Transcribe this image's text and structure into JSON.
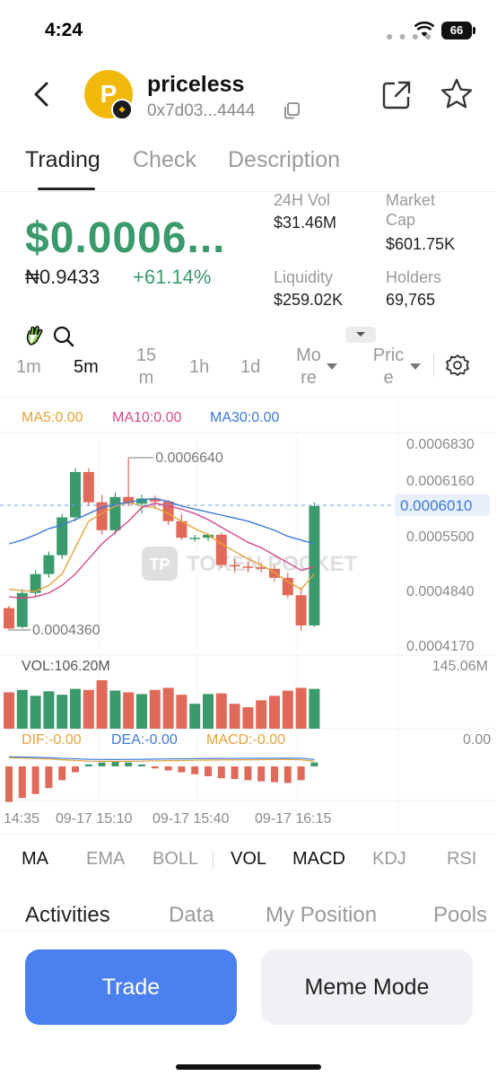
{
  "status_bar": {
    "time": "4:24",
    "battery": "66"
  },
  "header": {
    "token_name": "priceless",
    "token_address": "0x7d03...4444",
    "logo_letter": "P"
  },
  "tabs": [
    {
      "label": "Trading",
      "active": true
    },
    {
      "label": "Check",
      "active": false
    },
    {
      "label": "Description",
      "active": false
    }
  ],
  "price": {
    "usd": "$0.0006...",
    "ngn": "₦0.9433",
    "change": "+61.14%",
    "up_color": "#3b9a6b",
    "down_color": "#e06a5a"
  },
  "stats": {
    "vol_label": "24H Vol",
    "vol_value": "$31.46M",
    "mcap_label": "Market Cap",
    "mcap_value": "$601.75K",
    "liq_label": "Liquidity",
    "liq_value": "$259.02K",
    "holders_label": "Holders",
    "holders_value": "69,765"
  },
  "timeframes": {
    "items": [
      "1m",
      "5m",
      "15 m",
      "1h",
      "1d"
    ],
    "active": "5m",
    "more_label": "Mo re",
    "price_label": "Pric e"
  },
  "chart_data": {
    "type": "candlestick",
    "ma_labels": {
      "ma5": "MA5:0.00",
      "ma10": "MA10:0.00",
      "ma30": "MA30:0.00",
      "ma5_color": "#e6a23c",
      "ma10_color": "#d6488e",
      "ma30_color": "#3c7ad6"
    },
    "y_ticks": [
      "0.0006830",
      "0.0006160",
      "0.0005500",
      "0.0004840",
      "0.0004170"
    ],
    "ylim": [
      0.000417,
      0.000683
    ],
    "current_price": "0.0006010",
    "current_value": 0.000601,
    "high_marker": "0.0006640",
    "high_value": 0.000664,
    "low_marker": "0.0004360",
    "low_value": 0.000436,
    "candles": [
      {
        "o": 0.000465,
        "h": 0.000468,
        "l": 0.000436,
        "c": 0.000438
      },
      {
        "o": 0.00044,
        "h": 0.00049,
        "l": 0.000438,
        "c": 0.000485
      },
      {
        "o": 0.000485,
        "h": 0.000515,
        "l": 0.00048,
        "c": 0.00051
      },
      {
        "o": 0.00051,
        "h": 0.00054,
        "l": 0.000505,
        "c": 0.000535
      },
      {
        "o": 0.000535,
        "h": 0.00059,
        "l": 0.00053,
        "c": 0.000585
      },
      {
        "o": 0.000585,
        "h": 0.00065,
        "l": 0.00058,
        "c": 0.000645
      },
      {
        "o": 0.000645,
        "h": 0.00065,
        "l": 0.0006,
        "c": 0.000605
      },
      {
        "o": 0.000605,
        "h": 0.000615,
        "l": 0.000562,
        "c": 0.000568
      },
      {
        "o": 0.000568,
        "h": 0.000618,
        "l": 0.000562,
        "c": 0.000612
      },
      {
        "o": 0.000612,
        "h": 0.000664,
        "l": 0.0006,
        "c": 0.000603
      },
      {
        "o": 0.000603,
        "h": 0.000615,
        "l": 0.00059,
        "c": 0.00061
      },
      {
        "o": 0.00061,
        "h": 0.000614,
        "l": 0.000596,
        "c": 0.000606
      },
      {
        "o": 0.000606,
        "h": 0.000608,
        "l": 0.000575,
        "c": 0.00058
      },
      {
        "o": 0.00058,
        "h": 0.00059,
        "l": 0.000555,
        "c": 0.000558
      },
      {
        "o": 0.000558,
        "h": 0.000562,
        "l": 0.000553,
        "c": 0.000558
      },
      {
        "o": 0.000558,
        "h": 0.000564,
        "l": 0.000554,
        "c": 0.000562
      },
      {
        "o": 0.000562,
        "h": 0.000565,
        "l": 0.000518,
        "c": 0.000522
      },
      {
        "o": 0.000522,
        "h": 0.00053,
        "l": 0.000512,
        "c": 0.00052
      },
      {
        "o": 0.00052,
        "h": 0.000526,
        "l": 0.000512,
        "c": 0.000519
      },
      {
        "o": 0.000519,
        "h": 0.000525,
        "l": 0.000512,
        "c": 0.000517
      },
      {
        "o": 0.000517,
        "h": 0.000522,
        "l": 0.0005,
        "c": 0.000505
      },
      {
        "o": 0.000505,
        "h": 0.000512,
        "l": 0.000478,
        "c": 0.000482
      },
      {
        "o": 0.000482,
        "h": 0.000492,
        "l": 0.000435,
        "c": 0.000442
      },
      {
        "o": 0.000442,
        "h": 0.000605,
        "l": 0.00044,
        "c": 0.0006
      }
    ],
    "ma5": [
      0.00049,
      0.000488,
      0.000487,
      0.000495,
      0.00051,
      0.000545,
      0.00058,
      0.00059,
      0.0006,
      0.000605,
      0.0006,
      0.000598,
      0.00059,
      0.00058,
      0.00057,
      0.000562,
      0.00055,
      0.00054,
      0.00053,
      0.000522,
      0.000512,
      0.0005,
      0.00049,
      0.00051
    ],
    "ma10": [
      0.00048,
      0.000478,
      0.00048,
      0.000485,
      0.000495,
      0.00051,
      0.00053,
      0.00055,
      0.000565,
      0.00058,
      0.000598,
      0.000604,
      0.0006,
      0.000596,
      0.00059,
      0.000582,
      0.000572,
      0.000562,
      0.000552,
      0.000545,
      0.000535,
      0.000525,
      0.000515,
      0.00052
    ],
    "ma30": [
      0.00055,
      0.000555,
      0.000562,
      0.00057,
      0.000575,
      0.000582,
      0.00059,
      0.000598,
      0.000602,
      0.000605,
      0.000608,
      0.00061,
      0.000606,
      0.0006,
      0.000596,
      0.000592,
      0.000588,
      0.000584,
      0.00058,
      0.000574,
      0.000568,
      0.00056,
      0.000555,
      0.00055
    ],
    "volume_label": "VOL:106.20M",
    "volume_max_label": "145.06M",
    "volume_max": 145.06,
    "volumes": [
      105,
      112,
      95,
      108,
      98,
      115,
      112,
      140,
      110,
      105,
      100,
      112,
      118,
      98,
      72,
      100,
      102,
      72,
      62,
      82,
      95,
      110,
      118,
      115
    ],
    "macd_labels": {
      "dif": "DIF:-0.00",
      "dea": "DEA:-0.00",
      "macd": "MACD:-0.00",
      "zero": "0.00"
    },
    "macd_hist": [
      -0.9,
      -0.8,
      -0.7,
      -0.55,
      -0.35,
      -0.15,
      0.05,
      0.1,
      0.12,
      0.1,
      0.05,
      -0.05,
      -0.1,
      -0.15,
      -0.2,
      -0.25,
      -0.3,
      -0.32,
      -0.35,
      -0.38,
      -0.4,
      -0.42,
      -0.35,
      0.1
    ],
    "x_labels": [
      "14:35",
      "09-17 15:10",
      "09-17 15:40",
      "09-17 16:15"
    ],
    "watermark": "TOKEN POCKET"
  },
  "indicators": [
    {
      "label": "MA",
      "active": true
    },
    {
      "label": "EMA",
      "active": false
    },
    {
      "label": "BOLL",
      "active": false
    },
    {
      "label": "VOL",
      "active": true
    },
    {
      "label": "MACD",
      "active": true
    },
    {
      "label": "KDJ",
      "active": false
    },
    {
      "label": "RSI",
      "active": false
    }
  ],
  "bottom_tabs": [
    {
      "label": "Activities",
      "active": true
    },
    {
      "label": "Data",
      "active": false
    },
    {
      "label": "My Position",
      "active": false
    },
    {
      "label": "Pools",
      "active": false
    }
  ],
  "actions": {
    "trade": "Trade",
    "meme": "Meme Mode"
  }
}
